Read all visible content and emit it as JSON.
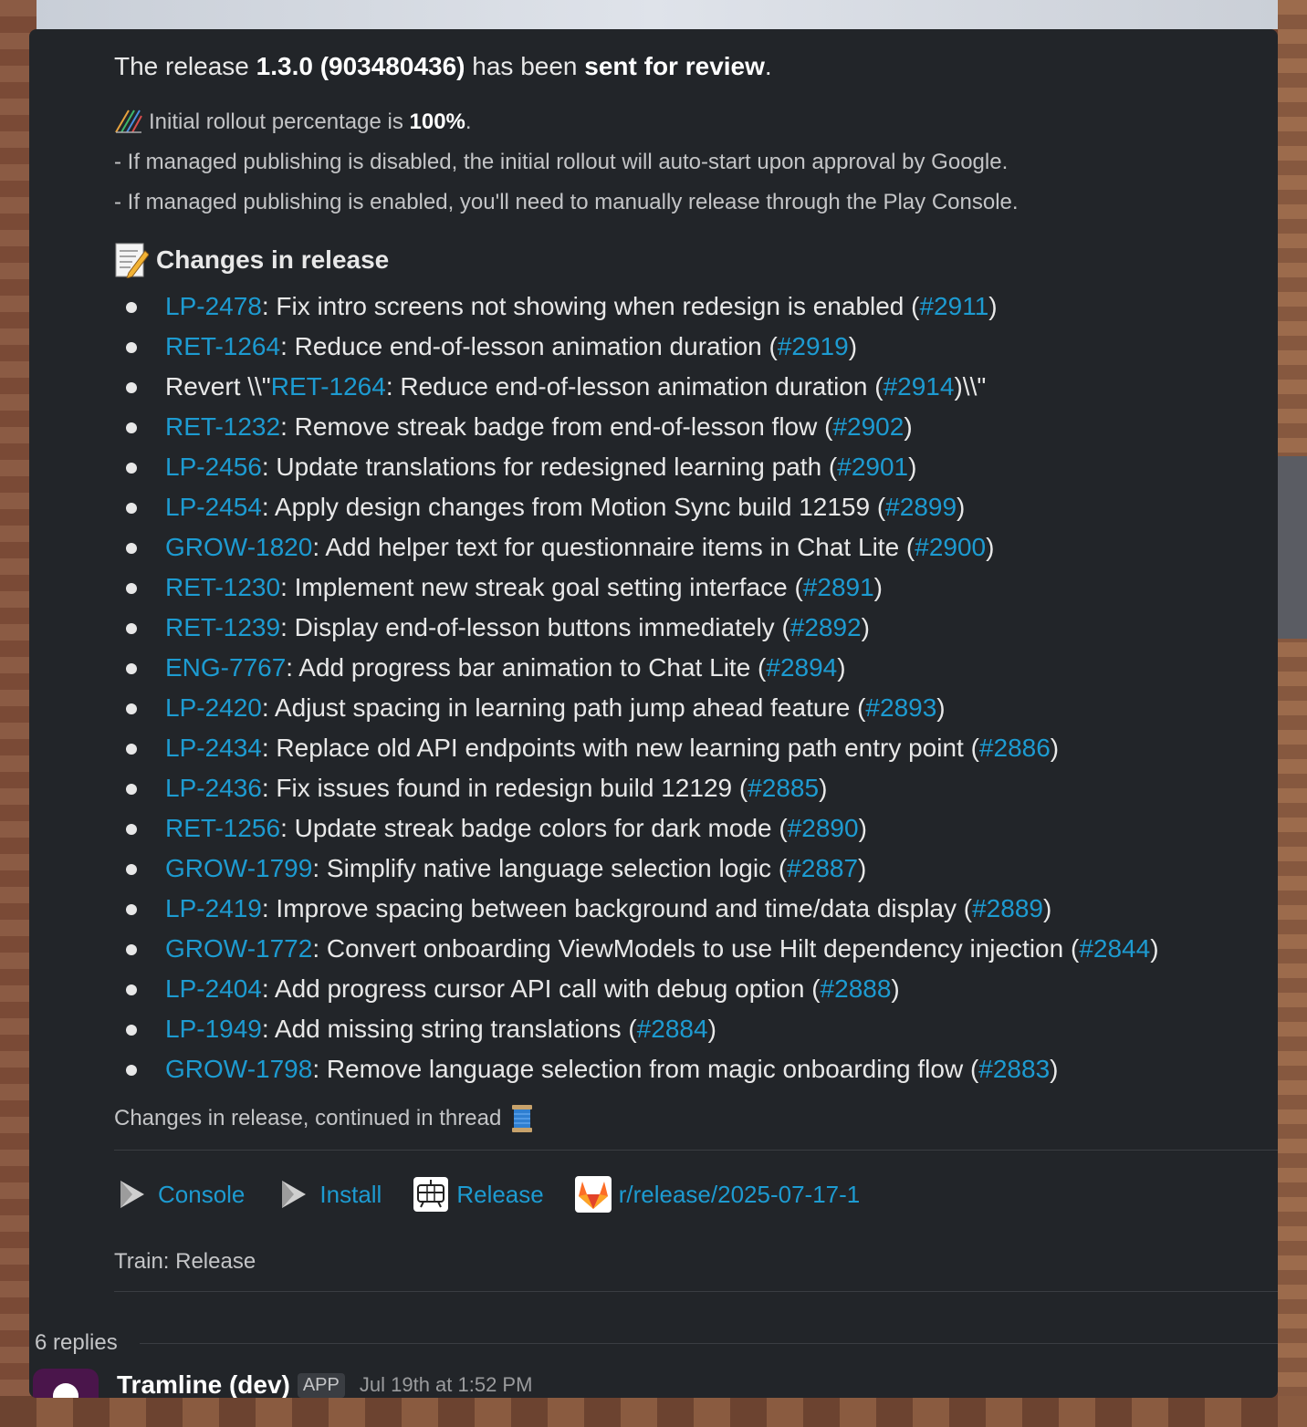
{
  "headline": {
    "prefix": "The release ",
    "version": "1.3.0 (903480436)",
    "middle": " has been ",
    "status": "sent for review",
    "suffix": "."
  },
  "rollout": {
    "label": "Initial rollout percentage is ",
    "value": "100%",
    "suffix": ".",
    "note1": "- If managed publishing is disabled, the initial rollout will auto-start upon approval by Google.",
    "note2": "- If managed publishing is enabled, you'll need to manually release through the Play Console."
  },
  "changes_title": "Changes in release",
  "changes": [
    {
      "pre": "",
      "ticket": "LP-2478",
      "text": ": Fix intro screens not showing when redesign is enabled (",
      "pr": "#2911",
      "post": ")"
    },
    {
      "pre": "",
      "ticket": "RET-1264",
      "text": ": Reduce end-of-lesson animation duration (",
      "pr": "#2919",
      "post": ")"
    },
    {
      "pre": "Revert \\\\\"",
      "ticket": "RET-1264",
      "text": ": Reduce end-of-lesson animation duration (",
      "pr": "#2914",
      "post": ")\\\\\""
    },
    {
      "pre": "",
      "ticket": "RET-1232",
      "text": ": Remove streak badge from end-of-lesson flow (",
      "pr": "#2902",
      "post": ")"
    },
    {
      "pre": "",
      "ticket": "LP-2456",
      "text": ": Update translations for redesigned learning path (",
      "pr": "#2901",
      "post": ")"
    },
    {
      "pre": "",
      "ticket": "LP-2454",
      "text": ": Apply design changes from Motion Sync build 12159 (",
      "pr": "#2899",
      "post": ")"
    },
    {
      "pre": "",
      "ticket": "GROW-1820",
      "text": ": Add helper text for questionnaire items in Chat Lite (",
      "pr": "#2900",
      "post": ")"
    },
    {
      "pre": "",
      "ticket": "RET-1230",
      "text": ": Implement new streak goal setting interface (",
      "pr": "#2891",
      "post": ")"
    },
    {
      "pre": "",
      "ticket": "RET-1239",
      "text": ": Display end-of-lesson buttons immediately (",
      "pr": "#2892",
      "post": ")"
    },
    {
      "pre": "",
      "ticket": "ENG-7767",
      "text": ": Add progress bar animation to Chat Lite (",
      "pr": "#2894",
      "post": ")"
    },
    {
      "pre": "",
      "ticket": "LP-2420",
      "text": ": Adjust spacing in learning path jump ahead feature (",
      "pr": "#2893",
      "post": ")"
    },
    {
      "pre": "",
      "ticket": "LP-2434",
      "text": ": Replace old API endpoints with new learning path entry point (",
      "pr": "#2886",
      "post": ")"
    },
    {
      "pre": "",
      "ticket": "LP-2436",
      "text": ": Fix issues found in redesign build 12129 (",
      "pr": "#2885",
      "post": ")"
    },
    {
      "pre": "",
      "ticket": "RET-1256",
      "text": ": Update streak badge colors for dark mode (",
      "pr": "#2890",
      "post": ")"
    },
    {
      "pre": "",
      "ticket": "GROW-1799",
      "text": ": Simplify native language selection logic (",
      "pr": "#2887",
      "post": ")"
    },
    {
      "pre": "",
      "ticket": "LP-2419",
      "text": ": Improve spacing between background and time/data display (",
      "pr": "#2889",
      "post": ")"
    },
    {
      "pre": "",
      "ticket": "GROW-1772",
      "text": ": Convert onboarding ViewModels to use Hilt dependency injection (",
      "pr": "#2844",
      "post": ")"
    },
    {
      "pre": "",
      "ticket": "LP-2404",
      "text": ": Add progress cursor API call with debug option (",
      "pr": "#2888",
      "post": ")"
    },
    {
      "pre": "",
      "ticket": "LP-1949",
      "text": ": Add missing string translations (",
      "pr": "#2884",
      "post": ")"
    },
    {
      "pre": "",
      "ticket": "GROW-1798",
      "text": ": Remove language selection from magic onboarding flow (",
      "pr": "#2883",
      "post": ")"
    }
  ],
  "continued": "Changes in release, continued in thread",
  "actions": {
    "console": "Console",
    "install": "Install",
    "release": "Release",
    "branch": "r/release/2025-07-17-1"
  },
  "train": "Train: Release",
  "replies": "6 replies",
  "next_message": {
    "sender": "Tramline (dev)",
    "badge": "APP",
    "timestamp": "Jul 19th at 1:52 PM"
  },
  "colors": {
    "panel": "#222529",
    "link": "#1d9bd1",
    "text": "#e8e8e8"
  },
  "icons": {
    "rollout": "chart-increasing-icon",
    "changes": "memo-icon",
    "continued": "spool-of-thread-icon",
    "console": "play-icon",
    "install": "play-icon",
    "release": "tram-icon",
    "branch": "gitlab-icon"
  }
}
